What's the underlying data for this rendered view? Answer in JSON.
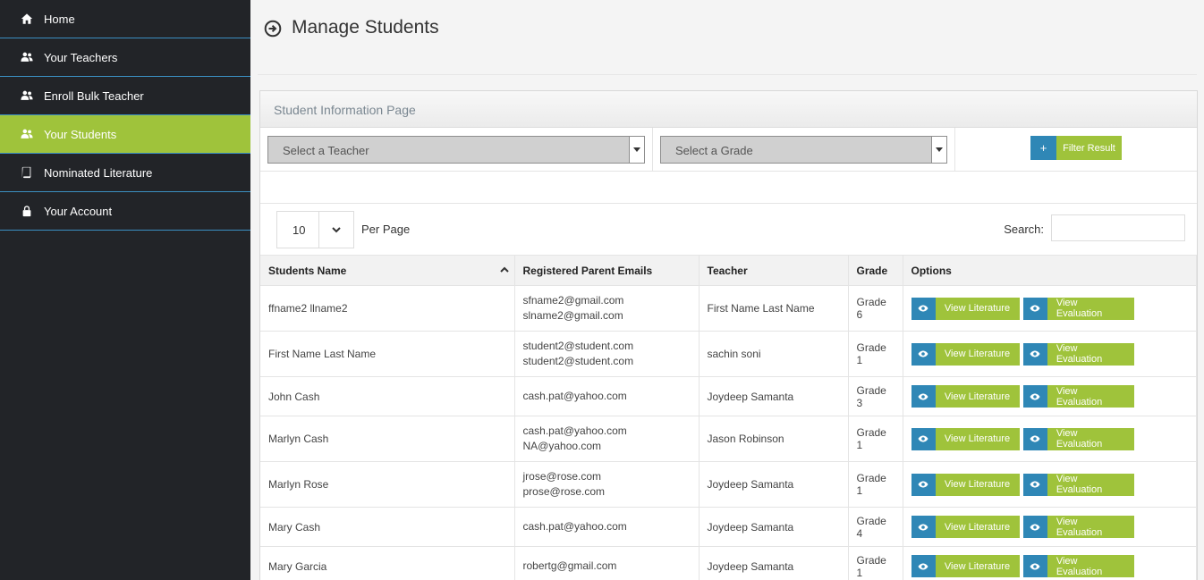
{
  "sidebar": {
    "items": [
      {
        "label": "Home",
        "icon": "home-icon",
        "active": false
      },
      {
        "label": "Your Teachers",
        "icon": "users-icon",
        "active": false
      },
      {
        "label": "Enroll Bulk Teacher",
        "icon": "users-icon",
        "active": false
      },
      {
        "label": "Your Students",
        "icon": "users-icon",
        "active": true
      },
      {
        "label": "Nominated Literature",
        "icon": "book-icon",
        "active": false
      },
      {
        "label": "Your Account",
        "icon": "lock-icon",
        "active": false
      }
    ]
  },
  "page": {
    "title": "Manage Students"
  },
  "panel": {
    "heading": "Student Information Page",
    "teacher_select": "Select a Teacher",
    "grade_select": "Select a Grade",
    "filter_icon": "+",
    "filter_label": "Filter Result"
  },
  "controls": {
    "per_page_value": "10",
    "per_page_label": "Per Page",
    "search_label": "Search:"
  },
  "table": {
    "headers": [
      "Students Name",
      "Registered Parent Emails",
      "Teacher",
      "Grade",
      "Options"
    ],
    "view_literature": "View Literature",
    "view_evaluation": "View Evaluation",
    "rows": [
      {
        "name": "ffname2 llname2",
        "emails": [
          "sfname2@gmail.com",
          "slname2@gmail.com"
        ],
        "teacher": "First Name Last Name",
        "grade": "Grade 6"
      },
      {
        "name": "First Name Last Name",
        "emails": [
          "student2@student.com",
          "student2@student.com"
        ],
        "teacher": "sachin soni",
        "grade": "Grade 1"
      },
      {
        "name": "John Cash",
        "emails": [
          "cash.pat@yahoo.com"
        ],
        "teacher": "Joydeep Samanta",
        "grade": "Grade 3"
      },
      {
        "name": "Marlyn Cash",
        "emails": [
          "cash.pat@yahoo.com",
          "NA@yahoo.com"
        ],
        "teacher": "Jason Robinson",
        "grade": "Grade 1"
      },
      {
        "name": "Marlyn Rose",
        "emails": [
          "jrose@rose.com",
          "prose@rose.com"
        ],
        "teacher": "Joydeep Samanta",
        "grade": "Grade 1"
      },
      {
        "name": "Mary Cash",
        "emails": [
          "cash.pat@yahoo.com"
        ],
        "teacher": "Joydeep Samanta",
        "grade": "Grade 4"
      },
      {
        "name": "Mary Garcia",
        "emails": [
          "robertg@gmail.com"
        ],
        "teacher": "Joydeep Samanta",
        "grade": "Grade 1"
      }
    ]
  },
  "colors": {
    "sidebar_bg": "#222428",
    "accent_green": "#9fc33b",
    "accent_blue": "#2f87b6"
  }
}
